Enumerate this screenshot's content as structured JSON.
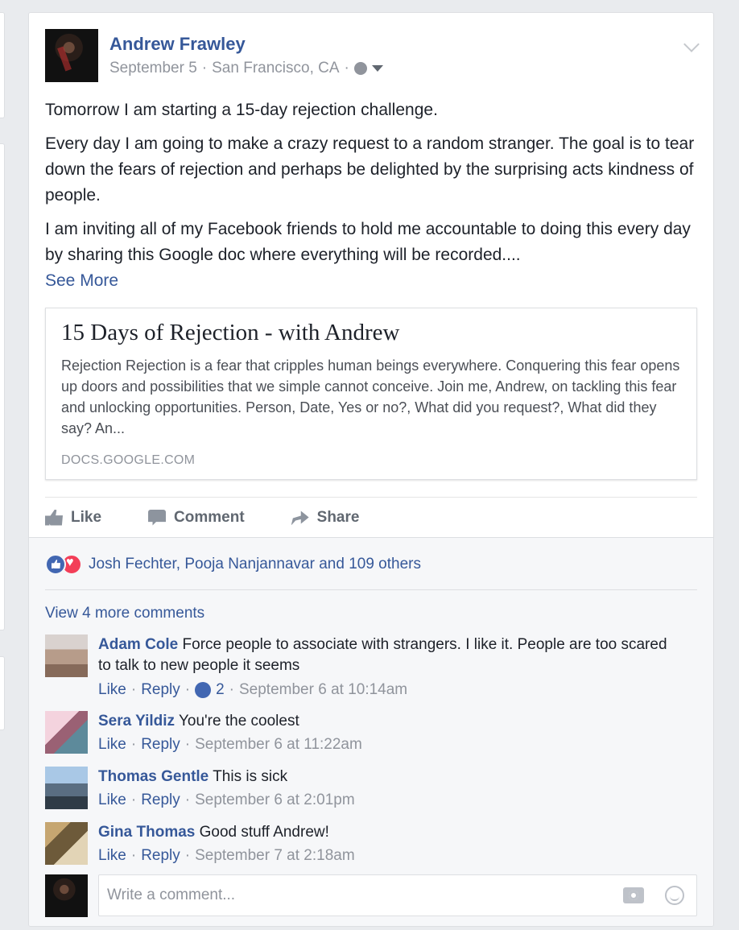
{
  "post": {
    "author": "Andrew Frawley",
    "date": "September 5",
    "separator": "·",
    "location": "San Francisco, CA",
    "privacy_icon": "globe-icon",
    "paragraphs": [
      "Tomorrow I am starting a 15-day rejection challenge.",
      "Every day I am going to make a crazy request to a random stranger. The goal is to tear down the fears of rejection and perhaps be delighted by the surprising acts kindness of people.",
      "I am inviting all of my Facebook friends to hold me accountable to doing this every day by sharing this Google doc where everything will be recorded...."
    ],
    "see_more": "See More"
  },
  "link_card": {
    "title": "15 Days of Rejection - with Andrew",
    "description": "Rejection Rejection is a fear that cripples human beings everywhere. Conquering this fear opens up doors and possibilities that we simple cannot conceive. Join me, Andrew, on tackling this fear and unlocking opportunities. Person, Date, Yes or no?, What did you request?, What did they say? An...",
    "domain": "DOCS.GOOGLE.COM"
  },
  "actions": {
    "like": "Like",
    "comment": "Comment",
    "share": "Share"
  },
  "reactions": {
    "summary": "Josh Fechter, Pooja Nanjannavar and 109 others"
  },
  "comments_section": {
    "view_more": "View 4 more comments",
    "comments": [
      {
        "name": "Adam Cole",
        "text": "Force people to associate with strangers. I like it. People are too scared to talk to new people it seems",
        "like": "Like",
        "reply": "Reply",
        "like_count": "2",
        "time": "September 6 at 10:14am"
      },
      {
        "name": "Sera Yildiz",
        "text": "You're the coolest",
        "like": "Like",
        "reply": "Reply",
        "time": "September 6 at 11:22am"
      },
      {
        "name": "Thomas Gentle",
        "text": "This is sick",
        "like": "Like",
        "reply": "Reply",
        "time": "September 6 at 2:01pm"
      },
      {
        "name": "Gina Thomas",
        "text": "Good stuff Andrew!",
        "like": "Like",
        "reply": "Reply",
        "time": "September 7 at 2:18am"
      }
    ],
    "composer_placeholder": "Write a comment..."
  },
  "colors": {
    "link_blue": "#365899",
    "meta_gray": "#90949c",
    "like_blue": "#4267b2",
    "love_red": "#f33e58"
  }
}
